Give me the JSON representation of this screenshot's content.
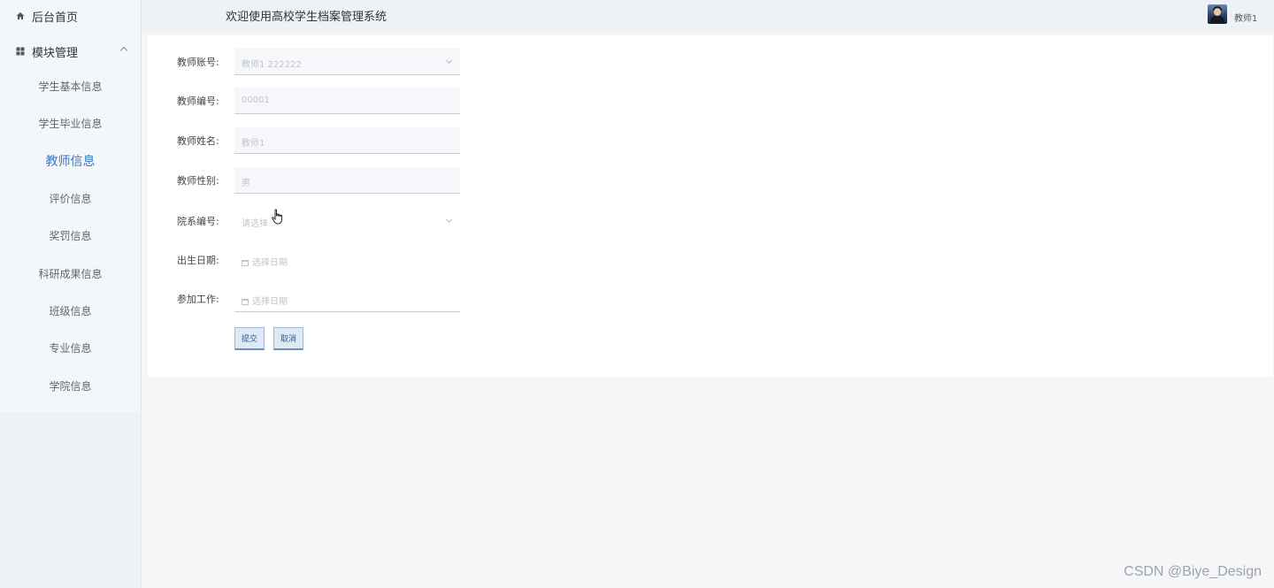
{
  "sidebar": {
    "home_label": "后台首页",
    "modules_label": "模块管理",
    "items": [
      {
        "label": "学生基本信息"
      },
      {
        "label": "学生毕业信息"
      },
      {
        "label": "教师信息"
      },
      {
        "label": "评价信息"
      },
      {
        "label": "奖罚信息"
      },
      {
        "label": "科研成果信息"
      },
      {
        "label": "班级信息"
      },
      {
        "label": "专业信息"
      },
      {
        "label": "学院信息"
      }
    ],
    "active_item": "教师信息"
  },
  "header": {
    "title": "欢迎使用高校学生档案管理系统",
    "user_name": "教师1"
  },
  "form": {
    "account": {
      "label": "教师账号:",
      "value": "教师1 222222"
    },
    "teacher_no": {
      "label": "教师编号:",
      "value": "00001"
    },
    "name": {
      "label": "教师姓名:",
      "value": "教师1"
    },
    "gender": {
      "label": "教师性别:",
      "value": "男"
    },
    "department": {
      "label": "院系编号:",
      "placeholder": "请选择"
    },
    "birth_date": {
      "label": "出生日期:",
      "placeholder": "选择日期"
    },
    "work_date": {
      "label": "参加工作:",
      "placeholder": "选择日期"
    },
    "submit_label": "提交",
    "cancel_label": "取消"
  },
  "watermark": "CSDN @Biye_Design",
  "colors": {
    "accent": "#3a77c2",
    "sidebar_bg": "#eef2f6",
    "button_bg": "#dde9f5"
  }
}
